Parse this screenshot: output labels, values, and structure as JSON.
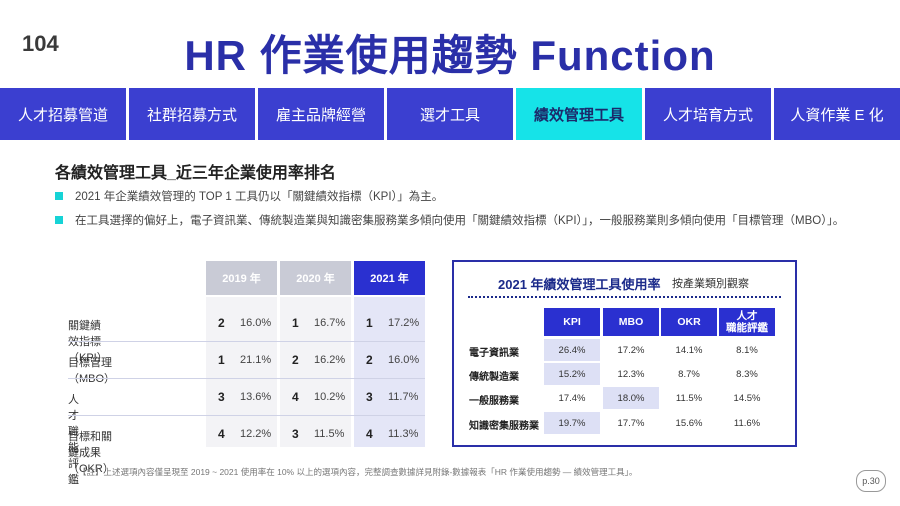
{
  "logo": {
    "text": "104"
  },
  "header": {
    "title": "HR 作業使用趨勢  Function"
  },
  "nav": {
    "tabs": [
      {
        "label": "人才招募管道"
      },
      {
        "label": "社群招募方式"
      },
      {
        "label": "雇主品牌經營"
      },
      {
        "label": "選才工具"
      },
      {
        "label": "績效管理工具"
      },
      {
        "label": "人才培育方式"
      },
      {
        "label": "人資作業 E 化"
      }
    ],
    "active_index": 4
  },
  "section": {
    "subtitle": "各績效管理工具_近三年企業使用率排名",
    "bullets": [
      "2021 年企業績效管理的 TOP 1 工具仍以「關鍵績效指標（KPI）」為主。",
      "在工具選擇的偏好上，電子資訊業、傳統製造業與知識密集服務業多傾向使用「關鍵績效指標（KPI）」，一般服務業則多傾向使用「目標管理（MBO）」。"
    ]
  },
  "rank_table": {
    "years": [
      "2019 年",
      "2020 年",
      "2021 年"
    ],
    "rows": [
      {
        "label": "關鍵績效指標（KPI）",
        "cells": [
          {
            "rank": "2",
            "pct": "16.0%"
          },
          {
            "rank": "1",
            "pct": "16.7%"
          },
          {
            "rank": "1",
            "pct": "17.2%"
          }
        ]
      },
      {
        "label": "目標管理（MBO）",
        "cells": [
          {
            "rank": "1",
            "pct": "21.1%"
          },
          {
            "rank": "2",
            "pct": "16.2%"
          },
          {
            "rank": "2",
            "pct": "16.0%"
          }
        ]
      },
      {
        "label": "人才職能評鑑",
        "cells": [
          {
            "rank": "3",
            "pct": "13.6%"
          },
          {
            "rank": "4",
            "pct": "10.2%"
          },
          {
            "rank": "3",
            "pct": "11.7%"
          }
        ]
      },
      {
        "label": "目標和關鍵成果（OKR）",
        "cells": [
          {
            "rank": "4",
            "pct": "12.2%"
          },
          {
            "rank": "3",
            "pct": "11.5%"
          },
          {
            "rank": "4",
            "pct": "11.3%"
          }
        ]
      }
    ]
  },
  "industry_panel": {
    "title": "2021 年績效管理工具使用率",
    "subtitle": "按產業類別觀察",
    "columns": [
      "KPI",
      "MBO",
      "OKR",
      "人才\n職能評鑑"
    ],
    "rows": [
      {
        "label": "電子資訊業",
        "values": [
          "26.4%",
          "17.2%",
          "14.1%",
          "8.1%"
        ],
        "highlight": 0
      },
      {
        "label": "傳統製造業",
        "values": [
          "15.2%",
          "12.3%",
          "8.7%",
          "8.3%"
        ],
        "highlight": 0
      },
      {
        "label": "一般服務業",
        "values": [
          "17.4%",
          "18.0%",
          "11.5%",
          "14.5%"
        ],
        "highlight": 1
      },
      {
        "label": "知識密集服務業",
        "values": [
          "19.7%",
          "17.7%",
          "15.6%",
          "11.6%"
        ],
        "highlight": 0
      }
    ]
  },
  "footer": {
    "note": "【註】上述選項內容僅呈現至 2019 ~ 2021 使用率在 10% 以上的選項內容，完整調查數據詳見附錄-數據報表「HR 作業使用趨勢 — 績效管理工具」。",
    "page": "p.30"
  },
  "colors": {
    "accent": "#2a2fa8",
    "nav": "#3b3fd0",
    "nav_active": "#16e3e8",
    "highlight": "#dde0f5"
  }
}
